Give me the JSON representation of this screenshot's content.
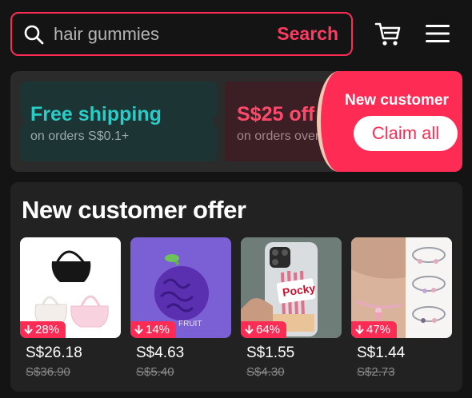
{
  "search": {
    "value": "hair gummies",
    "button_label": "Search"
  },
  "header_icons": [
    "search-icon",
    "cart-icon",
    "menu-icon"
  ],
  "colors": {
    "accent": "#fe2c55",
    "free_shipping": "#29ccc7",
    "background": "#141414"
  },
  "banner": {
    "free_shipping": {
      "title": "Free shipping",
      "subtitle": "on orders S$0.1+"
    },
    "discount": {
      "title": "S$25 off",
      "subtitle": "on orders over"
    },
    "new_customer_label": "New customer",
    "claim_button": "Claim all"
  },
  "offer": {
    "title": "New customer offer",
    "products": [
      {
        "image": "black-and-pastel-shoulder-bags",
        "discount": "28%",
        "price": "S$26.18",
        "original_price": "S$36.90"
      },
      {
        "image": "purple-devil-fruit-case",
        "image_text": "FRUIT",
        "discount": "14%",
        "price": "S$4.63",
        "original_price": "S$5.40"
      },
      {
        "image": "pocky-phone-case",
        "image_text": "Pocky",
        "discount": "64%",
        "price": "S$1.55",
        "original_price": "S$4.30"
      },
      {
        "image": "beaded-bracelets",
        "discount": "47%",
        "price": "S$1.44",
        "original_price": "S$2.73"
      }
    ]
  }
}
